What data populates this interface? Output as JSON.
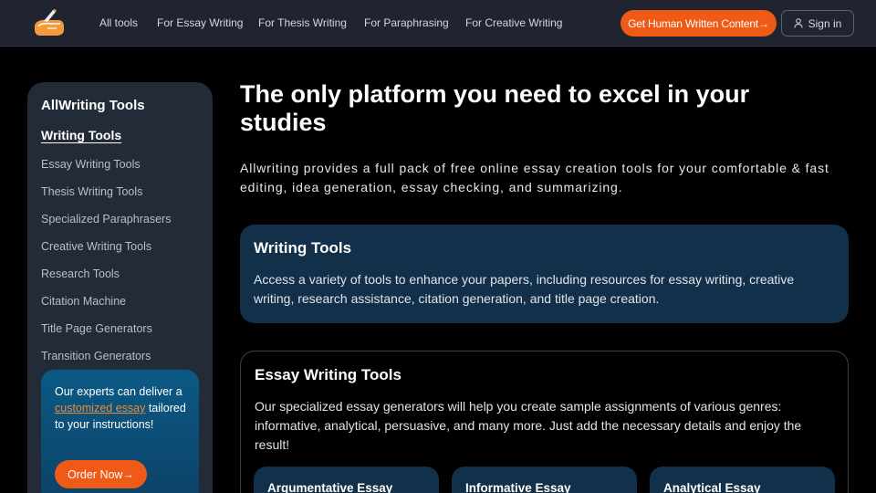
{
  "header": {
    "nav": [
      "All tools",
      "For Essay Writing",
      "For Thesis Writing",
      "For Paraphrasing",
      "For Creative Writing"
    ],
    "cta_label": "Get Human Written Content",
    "cta_arrow": "→",
    "signin_label": "Sign in"
  },
  "sidebar": {
    "title": "AllWriting Tools",
    "active": "Writing Tools",
    "items": [
      "Essay Writing Tools",
      "Thesis Writing Tools",
      "Specialized Paraphrasers",
      "Creative Writing Tools",
      "Research Tools",
      "Citation Machine",
      "Title Page Generators",
      "Transition Generators"
    ],
    "promo": {
      "text_before": "Our experts can deliver a ",
      "link": "customized essay",
      "text_after": " tailored to your instructions!",
      "button": "Order Now",
      "button_arrow": "→"
    }
  },
  "main": {
    "title": "The only platform you need to excel in your studies",
    "subtitle": "Allwriting provides a full pack of free online essay creation tools for your comfortable & fast editing, idea generation, essay checking, and summarizing.",
    "card1": {
      "title": "Writing Tools",
      "text": "Access a variety of tools to enhance your papers, including resources for essay writing, creative writing, research assistance, citation generation, and title page creation."
    },
    "card2": {
      "title": "Essay Writing Tools",
      "text": "Our specialized essay generators will help you create sample assignments of various genres: informative, analytical, persuasive, and many more. Just add the necessary details and enjoy the result!",
      "subcards": [
        "Argumentative Essay",
        "Informative Essay",
        "Analytical Essay"
      ]
    }
  },
  "colors": {
    "accent": "#ef5a16",
    "header_bg": "#1f2430",
    "sidebar_bg": "#232a38",
    "card_bg": "#12304a",
    "link": "#f08a3a"
  }
}
